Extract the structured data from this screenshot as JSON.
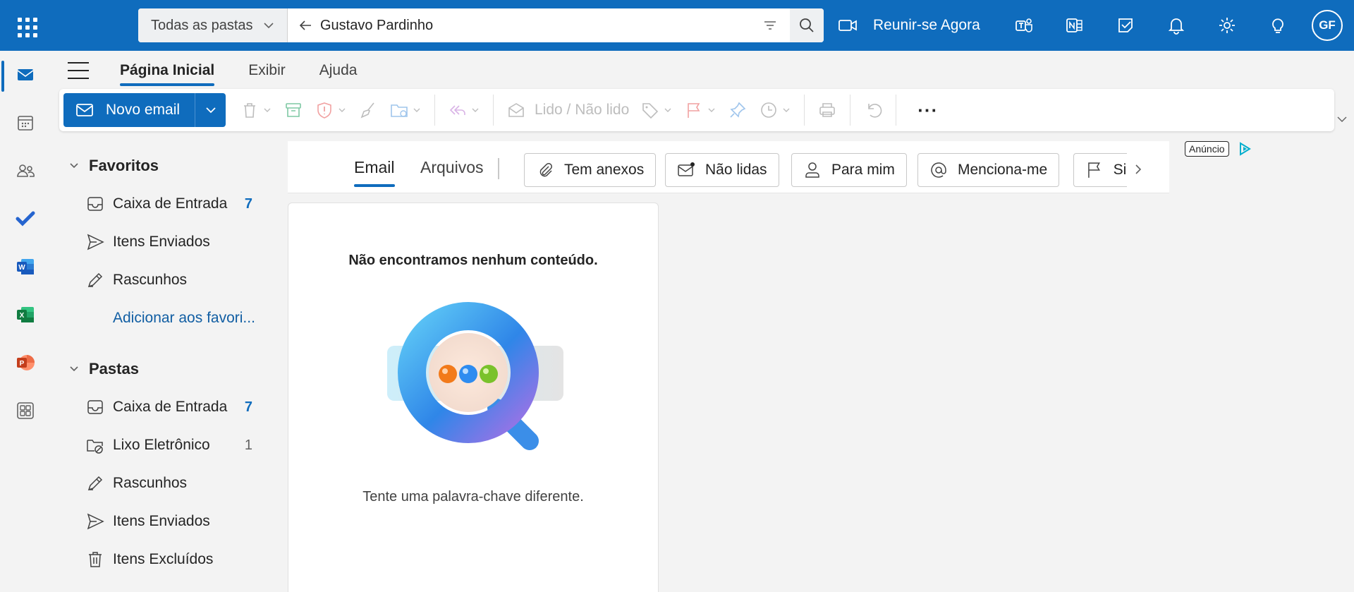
{
  "search": {
    "scope": "Todas as pastas",
    "query": "Gustavo Pardinho"
  },
  "header": {
    "meet_label": "Reunir-se Agora",
    "avatar_initials": "GF"
  },
  "ribbon": {
    "tabs": [
      "Página Inicial",
      "Exibir",
      "Ajuda"
    ]
  },
  "toolbar": {
    "new_email": "Novo email",
    "read_unread": "Lido / Não lido",
    "more": "···"
  },
  "folders": {
    "favorites_title": "Favoritos",
    "favorites": [
      {
        "label": "Caixa de Entrada",
        "count": "7",
        "icon": "inbox-icon"
      },
      {
        "label": "Itens Enviados",
        "count": "",
        "icon": "send-icon"
      },
      {
        "label": "Rascunhos",
        "count": "",
        "icon": "draft-icon"
      }
    ],
    "add_favorite": "Adicionar aos favori...",
    "folders_title": "Pastas",
    "items": [
      {
        "label": "Caixa de Entrada",
        "count": "7",
        "icon": "inbox-icon"
      },
      {
        "label": "Lixo Eletrônico",
        "count": "1",
        "icon": "junk-icon"
      },
      {
        "label": "Rascunhos",
        "count": "",
        "icon": "draft-icon"
      },
      {
        "label": "Itens Enviados",
        "count": "",
        "icon": "send-icon"
      },
      {
        "label": "Itens Excluídos",
        "count": "",
        "icon": "trash-icon"
      }
    ]
  },
  "search_results": {
    "tabs": [
      "Email",
      "Arquivos"
    ],
    "filters": [
      "Tem anexos",
      "Não lidas",
      "Para mim",
      "Menciona-me",
      "Sinalizadas"
    ],
    "empty_title": "Não encontramos nenhum conteúdo.",
    "empty_subtitle": "Tente uma palavra-chave diferente."
  },
  "ad": {
    "label": "Anúncio"
  },
  "colors": {
    "brand": "#0f6cbd",
    "unread_count": "#0f6cbd"
  }
}
